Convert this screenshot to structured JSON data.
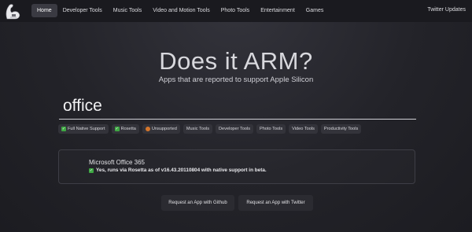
{
  "nav": {
    "items": [
      {
        "label": "Home"
      },
      {
        "label": "Developer Tools"
      },
      {
        "label": "Music Tools"
      },
      {
        "label": "Video and Motion Tools"
      },
      {
        "label": "Photo Tools"
      },
      {
        "label": "Entertainment"
      },
      {
        "label": "Games"
      }
    ],
    "right_label": "Twitter Updates",
    "logo_icon": "arm-flex-icon"
  },
  "hero": {
    "title": "Does it ARM?",
    "subtitle": "Apps that are reported to support Apple Silicon"
  },
  "search": {
    "value": "office"
  },
  "filters": [
    {
      "label": "Full Native Support",
      "icon": "check-icon",
      "color": "#3ea743"
    },
    {
      "label": "Rosetta",
      "icon": "check-icon",
      "color": "#3ea743"
    },
    {
      "label": "Unsupported",
      "icon": "stop-icon",
      "color": "#d5762b"
    },
    {
      "label": "Music Tools"
    },
    {
      "label": "Developer Tools"
    },
    {
      "label": "Photo Tools"
    },
    {
      "label": "Video Tools"
    },
    {
      "label": "Productivity Tools"
    }
  ],
  "result": {
    "title": "Microsoft Office 365",
    "status": "Yes, runs via Rosetta as of v16.43.20110804 with native support in beta.",
    "status_icon": "check-icon",
    "status_color": "#3ea743"
  },
  "buttons": {
    "github_label": "Request an App with Github",
    "twitter_label": "Request an App with Twitter"
  },
  "colors": {
    "accent_green": "#3ea743",
    "accent_orange": "#d5762b",
    "nav_bg": "#1a1a1f"
  }
}
